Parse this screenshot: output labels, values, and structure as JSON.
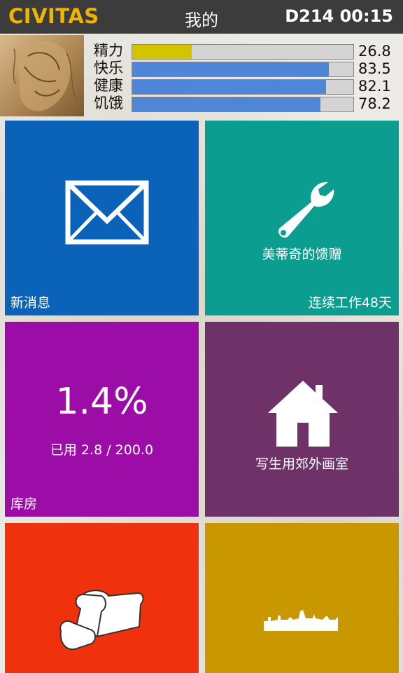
{
  "header": {
    "brand": "CIVITAS",
    "title": "我的",
    "clock": "D214 00:15"
  },
  "stats": [
    {
      "label": "精力",
      "value": "26.8",
      "fraction": 0.268,
      "color": "#d4c400"
    },
    {
      "label": "快乐",
      "value": "83.5",
      "fraction": 0.888,
      "color": "#4f86d8"
    },
    {
      "label": "健康",
      "value": "82.1",
      "fraction": 0.875,
      "color": "#4f86d8"
    },
    {
      "label": "饥饿",
      "value": "78.2",
      "fraction": 0.85,
      "color": "#4f86d8"
    }
  ],
  "tiles": {
    "messages": {
      "caption": "新消息",
      "color": "#0a63b8",
      "icon": "envelope-icon"
    },
    "gift": {
      "label": "美蒂奇的馈赠",
      "caption": "连续工作48天",
      "color": "#0b9d8f",
      "icon": "wrench-icon"
    },
    "warehouse": {
      "percent": "1.4%",
      "used": "已用 2.8 / 200.0",
      "caption": "库房",
      "color": "#9b0da6"
    },
    "home": {
      "label": "写生用郊外画室",
      "color": "#6e3168",
      "icon": "house-icon"
    },
    "food": {
      "color": "#ef310d",
      "icon": "bread-icon"
    },
    "city": {
      "color": "#c99800",
      "icon": "city-skyline-icon"
    }
  }
}
